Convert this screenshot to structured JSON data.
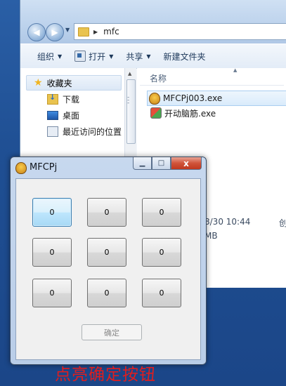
{
  "explorer": {
    "address": "mfc",
    "toolbar": [
      {
        "label": "组织",
        "has_caret": true
      },
      {
        "label": "打开",
        "has_caret": true,
        "icon": "open-icon"
      },
      {
        "label": "共享",
        "has_caret": true
      },
      {
        "label": "新建文件夹",
        "has_caret": false
      }
    ],
    "nav": {
      "favorites": "收藏夹",
      "items": [
        "下载",
        "桌面",
        "最近访问的位置"
      ]
    },
    "column_header": "名称",
    "files": [
      {
        "name": "MFCPj003.exe",
        "selected": true
      },
      {
        "name": "开动脑筋.exe",
        "selected": false
      }
    ],
    "details": {
      "date": "8/30 10:44",
      "size_unit": "MB",
      "trailing": "创"
    }
  },
  "dialog": {
    "title": "MFCPj",
    "buttons": [
      "0",
      "0",
      "0",
      "0",
      "0",
      "0",
      "0",
      "0",
      "0"
    ],
    "ok_label": "确定",
    "close_glyph": "x"
  },
  "annotation": "点亮确定按钮"
}
